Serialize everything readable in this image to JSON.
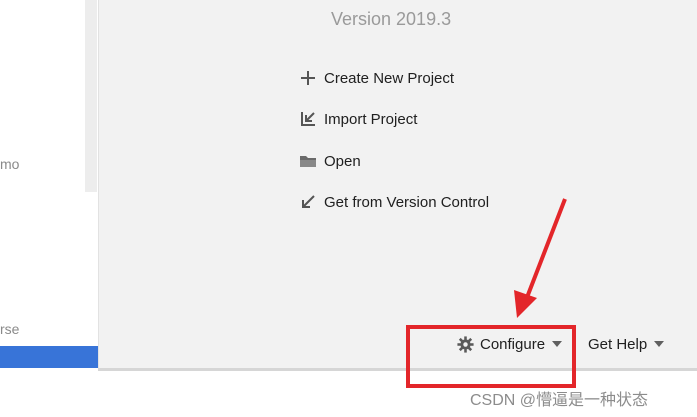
{
  "sidebar": {
    "fragments": [
      "mo",
      "rse"
    ]
  },
  "welcome": {
    "version": "Version 2019.3",
    "actions": [
      {
        "label": "Create New Project",
        "icon": "plus-icon"
      },
      {
        "label": "Import Project",
        "icon": "import-arrow-icon"
      },
      {
        "label": "Open",
        "icon": "folder-icon"
      },
      {
        "label": "Get from Version Control",
        "icon": "arrow-down-left-icon"
      }
    ]
  },
  "footer": {
    "configure_label": "Configure",
    "configure_icon": "gear-icon",
    "get_help_label": "Get Help"
  },
  "annotation": {
    "color": "#e3262a"
  },
  "watermark": "CSDN @懵逼是一种状态"
}
